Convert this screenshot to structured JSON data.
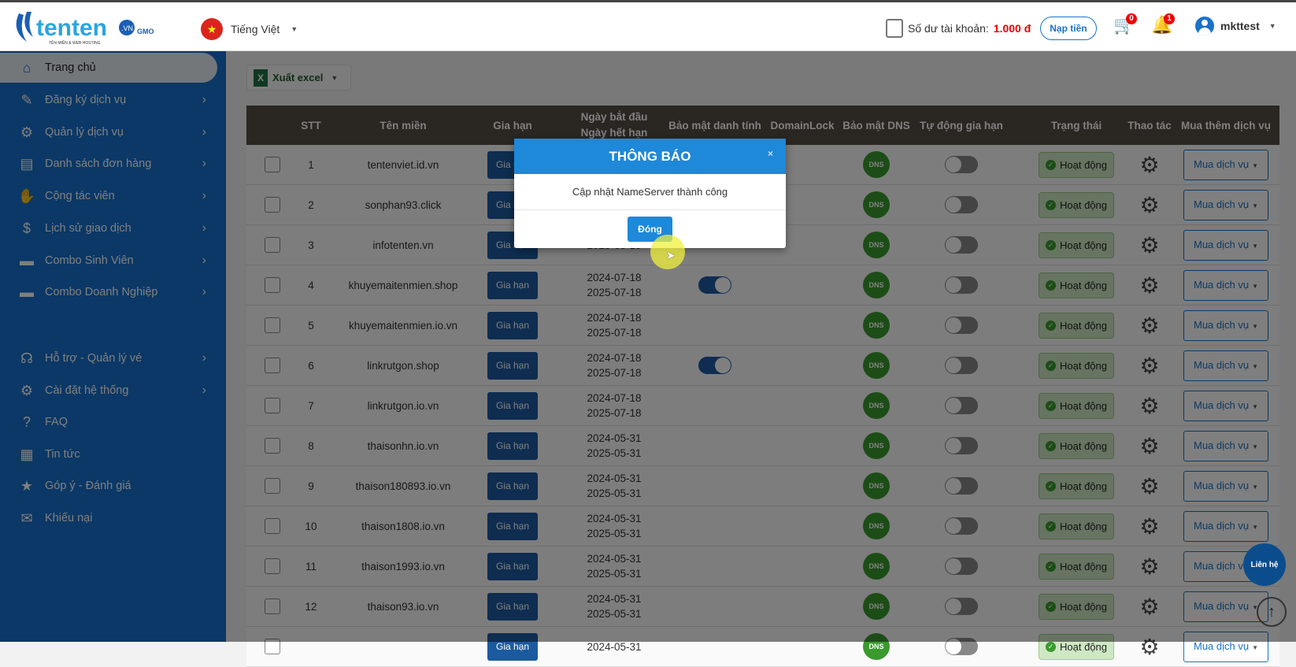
{
  "header": {
    "logo_text": "tenten.vn",
    "logo_tagline": "TÊN MIỀN & WEB HOSTING",
    "logo_by": "by GMO",
    "language": "Tiếng Việt",
    "balance_label": "Số dư tài khoản:",
    "balance_value": "1.000 đ",
    "topup_label": "Nạp tiền",
    "cart_count": "0",
    "notification_count": "1",
    "username": "mkttest"
  },
  "sidebar": {
    "items": [
      {
        "label": "Trang chủ",
        "icon": "home-icon",
        "active": true,
        "chevron": false
      },
      {
        "label": "Đăng ký dịch vụ",
        "icon": "pencil-icon",
        "chevron": true
      },
      {
        "label": "Quản lý dịch vụ",
        "icon": "gear-icon",
        "chevron": true
      },
      {
        "label": "Danh sách đơn hàng",
        "icon": "order-list-icon",
        "chevron": true
      },
      {
        "label": "Cộng tác viên",
        "icon": "handshake-icon",
        "chevron": true
      },
      {
        "label": "Lịch sử giao dịch",
        "icon": "transaction-history-icon",
        "chevron": true
      },
      {
        "label": "Combo Sinh Viên",
        "icon": "folder-icon",
        "chevron": true
      },
      {
        "label": "Combo Doanh Nghiệp",
        "icon": "folder-icon",
        "chevron": true
      },
      {
        "label": "Hỗ trợ - Quản lý vé",
        "icon": "support-icon",
        "chevron": true
      },
      {
        "label": "Cài đặt hệ thống",
        "icon": "settings-icon",
        "chevron": true
      },
      {
        "label": "FAQ",
        "icon": "faq-icon",
        "chevron": false
      },
      {
        "label": "Tin tức",
        "icon": "news-icon",
        "chevron": false
      },
      {
        "label": "Góp ý - Đánh giá",
        "icon": "feedback-icon",
        "chevron": false
      },
      {
        "label": "Khiếu nại",
        "icon": "complaint-icon",
        "chevron": false
      }
    ]
  },
  "toolbar": {
    "export_label": "Xuất excel"
  },
  "table": {
    "columns": [
      "STT",
      "Tên miền",
      "Gia hạn",
      "Ngày bắt đầu",
      "Ngày hết hạn",
      "Bảo mật danh tính",
      "DomainLock",
      "Bảo mật DNS",
      "Tự động gia hạn",
      "Trạng thái",
      "Thao tác",
      "Mua thêm dịch vụ"
    ],
    "renew_label": "Gia hạn",
    "status_label": "Hoạt động",
    "buy_label": "Mua dịch vụ",
    "dns_label": "DNS",
    "rows": [
      {
        "stt": "1",
        "domain": "tentenviet.id.vn",
        "start": "",
        "end": "",
        "privacy": false
      },
      {
        "stt": "2",
        "domain": "sonphan93.click",
        "start": "",
        "end": "",
        "privacy": false
      },
      {
        "stt": "3",
        "domain": "infotenten.vn",
        "start": "",
        "end": "2025-08-15",
        "privacy": false
      },
      {
        "stt": "4",
        "domain": "khuyemaitenmien.shop",
        "start": "2024-07-18",
        "end": "2025-07-18",
        "privacy": true
      },
      {
        "stt": "5",
        "domain": "khuyemaitenmien.io.vn",
        "start": "2024-07-18",
        "end": "2025-07-18",
        "privacy": false
      },
      {
        "stt": "6",
        "domain": "linkrutgon.shop",
        "start": "2024-07-18",
        "end": "2025-07-18",
        "privacy": true
      },
      {
        "stt": "7",
        "domain": "linkrutgon.io.vn",
        "start": "2024-07-18",
        "end": "2025-07-18",
        "privacy": false
      },
      {
        "stt": "8",
        "domain": "thaisonhn.io.vn",
        "start": "2024-05-31",
        "end": "2025-05-31",
        "privacy": false
      },
      {
        "stt": "9",
        "domain": "thaison180893.io.vn",
        "start": "2024-05-31",
        "end": "2025-05-31",
        "privacy": false
      },
      {
        "stt": "10",
        "domain": "thaison1808.io.vn",
        "start": "2024-05-31",
        "end": "2025-05-31",
        "privacy": false
      },
      {
        "stt": "11",
        "domain": "thaison1993.io.vn",
        "start": "2024-05-31",
        "end": "2025-05-31",
        "privacy": false
      },
      {
        "stt": "12",
        "domain": "thaison93.io.vn",
        "start": "2024-05-31",
        "end": "2025-05-31",
        "privacy": false
      },
      {
        "stt": "",
        "domain": "",
        "start": "2024-05-31",
        "end": "",
        "privacy": false
      }
    ]
  },
  "modal": {
    "title": "THÔNG BÁO",
    "message": "Cập nhật NameServer thành công",
    "close_label": "Đóng",
    "close_icon": "×"
  },
  "floating": {
    "contact_label": "Liên hệ",
    "scroll_top_icon": "↑"
  },
  "colors": {
    "brand": "#1670cc",
    "accent": "#1e88d9",
    "status_ok": "#3a9a2e",
    "balance": "#e00000"
  }
}
